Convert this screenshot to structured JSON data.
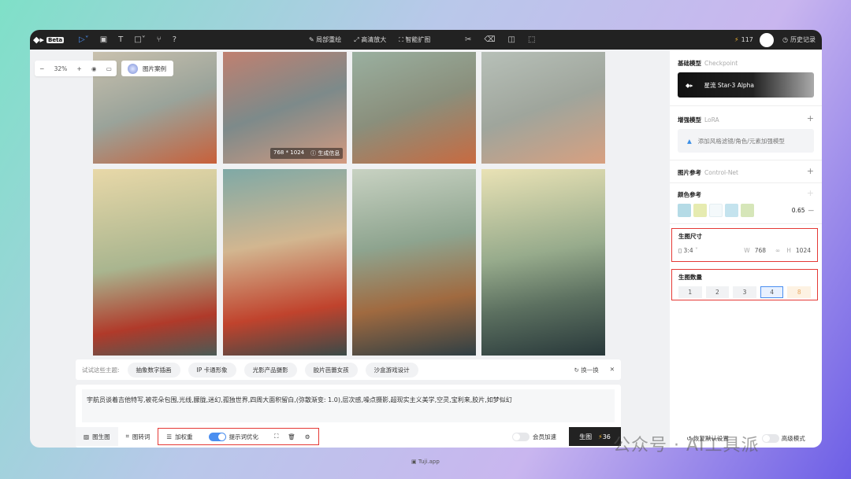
{
  "topbar": {
    "beta": "Beta",
    "tools": [
      "局部重绘",
      "高清放大",
      "智能扩图"
    ],
    "credits": "117",
    "history": "历史记录"
  },
  "canvas": {
    "zoom": "32%",
    "cases": "图片案例",
    "image_size": "768 * 1024",
    "gen_info": "生成信息"
  },
  "themes": {
    "label": "试试这些主题:",
    "chips": [
      "抽象数字插画",
      "IP 卡通形象",
      "光影产品摄影",
      "胶片芭蕾女孩",
      "沙盒游戏设计"
    ],
    "refresh": "换一换"
  },
  "prompt": {
    "text": "宇航员谈着吉他特写,被花朵包围,光线,朦胧,迷幻,孤独世界,四周大面积留白,(弥散渐变: 1.0),层次感,噪点摄影,超现实主义美学,空灵,宝利来,胶片,如梦似幻",
    "img2img": "图生图",
    "img2text": "图转词",
    "weight": "加权重",
    "optimize": "提示词优化",
    "optimize_on": true,
    "vip_speed": "会员加速",
    "vip_on": false,
    "generate": "生图",
    "cost": "36"
  },
  "sidebar": {
    "base_model": {
      "title": "基础模型",
      "sub": "Checkpoint",
      "name": "星流 Star-3 Alpha"
    },
    "lora": {
      "title": "增强模型",
      "sub": "LoRA",
      "placeholder": "添加风格滤镜/角色/元素加强模型"
    },
    "controlnet": {
      "title": "图片参考",
      "sub": "Control-Net"
    },
    "color": {
      "title": "颜色参考",
      "swatches": [
        "#b5dbe6",
        "#e6ebb0",
        "#f4f9fb",
        "#c4e3ee",
        "#d6e6b9"
      ],
      "strength": "0.65"
    },
    "size": {
      "title": "生图尺寸",
      "ratio": "3:4",
      "w_label": "W",
      "w": "768",
      "h_label": "H",
      "h": "1024"
    },
    "count": {
      "title": "生图数量",
      "options": [
        "1",
        "2",
        "3",
        "4",
        "8"
      ],
      "selected": "4"
    },
    "reset": "恢复默认设置",
    "advanced": "高级模式"
  },
  "watermark": "公众号 · AI工具派",
  "footer": "Tuji.app"
}
